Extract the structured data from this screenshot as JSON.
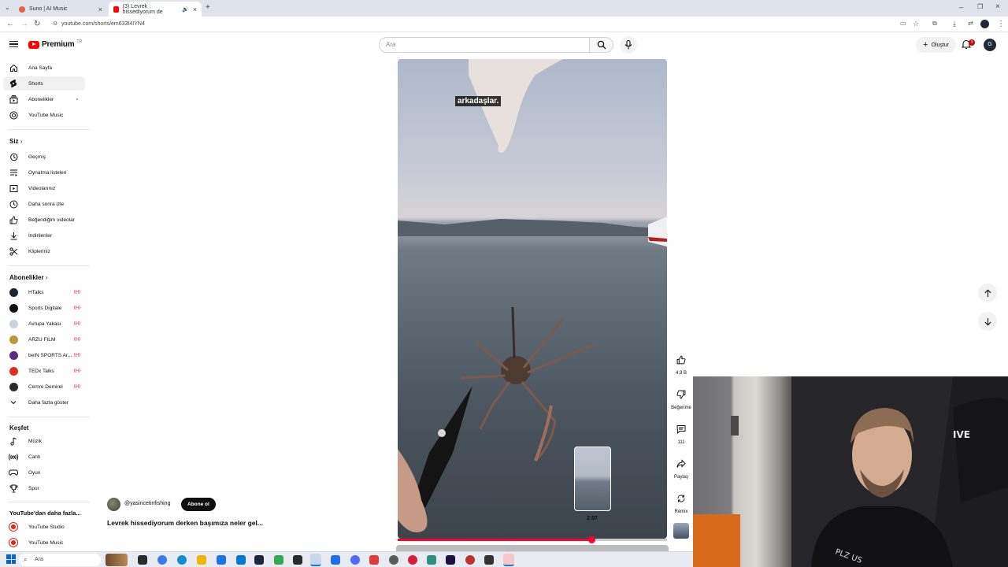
{
  "browser": {
    "tabs": [
      {
        "title": "Suno | AI Music",
        "active": false
      },
      {
        "title": "(3) Levrek hissediyorum de",
        "active": true
      }
    ],
    "url": "youtube.com/shorts/em633I4IYN4"
  },
  "header": {
    "logo_text": "Premium",
    "logo_country": "TR",
    "search_placeholder": "Ara",
    "create_label": "Oluştur",
    "notification_count": "3"
  },
  "sidebar": {
    "main": [
      {
        "label": "Ana Sayfa",
        "icon": "home-icon"
      },
      {
        "label": "Shorts",
        "icon": "shorts-icon",
        "active": true
      },
      {
        "label": "Abonelikler",
        "icon": "subscriptions-icon"
      },
      {
        "label": "YouTube Music",
        "icon": "music-disc-icon"
      }
    ],
    "you_heading": "Siz",
    "you": [
      {
        "label": "Geçmiş",
        "icon": "history-icon"
      },
      {
        "label": "Oynatma listeleri",
        "icon": "playlists-icon"
      },
      {
        "label": "Videolarınız",
        "icon": "your-videos-icon"
      },
      {
        "label": "Daha sonra izle",
        "icon": "watch-later-icon"
      },
      {
        "label": "Beğendiğim videolar",
        "icon": "liked-icon"
      },
      {
        "label": "İndirilenler",
        "icon": "download-icon"
      },
      {
        "label": "Klipleriniz",
        "icon": "scissors-icon"
      }
    ],
    "subs_heading": "Abonelikler",
    "subscriptions": [
      {
        "label": "HTalks",
        "color": "#1d2733"
      },
      {
        "label": "Sports Digitale",
        "color": "#111111"
      },
      {
        "label": "Avrupa Yakası",
        "color": "#c8d3db"
      },
      {
        "label": "ARZU FILM",
        "color": "#b59a3c"
      },
      {
        "label": "beIN SPORTS Ar...",
        "color": "#5b2a86"
      },
      {
        "label": "TEDx Talks",
        "color": "#e62b1e"
      },
      {
        "label": "Cemre Demirel",
        "color": "#2b2b2b"
      }
    ],
    "show_more": "Daha fazla göster",
    "explore_heading": "Keşfet",
    "explore": [
      {
        "label": "Müzik",
        "icon": "music-note-icon"
      },
      {
        "label": "Canlı",
        "icon": "live-icon"
      },
      {
        "label": "Oyun",
        "icon": "gamepad-icon"
      },
      {
        "label": "Spor",
        "icon": "trophy-icon"
      }
    ],
    "more_heading": "YouTube'dan daha fazla...",
    "more": [
      {
        "label": "YouTube Studio",
        "color": "#e62117"
      },
      {
        "label": "YouTube Music",
        "color": "#e62117"
      }
    ]
  },
  "video": {
    "caption": "arkadaşlar.",
    "channel": "@yasincetinfishing",
    "subscribe_label": "Abone ol",
    "title": "Levrek hissediyorum derken başımıza neler gel...",
    "preview_time": "2:07",
    "progress": 0.72
  },
  "actions": {
    "like_count": "4,9 B",
    "dislike_label": "Beğenme",
    "comment_count": "111",
    "share_label": "Paylaş",
    "remix_label": "Remix"
  },
  "taskbar": {
    "search_label": "Ara"
  },
  "colors": {
    "accent": "#ff0033",
    "youtube_red": "#ff0000"
  }
}
